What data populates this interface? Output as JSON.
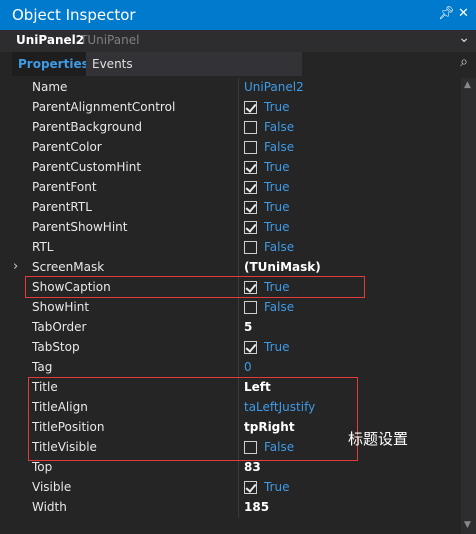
{
  "window": {
    "title": "Object Inspector"
  },
  "object": {
    "name": "UniPanel2",
    "type": "TUniPanel"
  },
  "tabs": {
    "properties": "Properties",
    "events": "Events"
  },
  "properties": [
    {
      "name": "Name",
      "value": "UniPanel2",
      "kind": "text",
      "style": "blue"
    },
    {
      "name": "ParentAlignmentControl",
      "value": "True",
      "kind": "check",
      "checked": true
    },
    {
      "name": "ParentBackground",
      "value": "False",
      "kind": "check",
      "checked": false
    },
    {
      "name": "ParentColor",
      "value": "False",
      "kind": "check",
      "checked": false
    },
    {
      "name": "ParentCustomHint",
      "value": "True",
      "kind": "check",
      "checked": true
    },
    {
      "name": "ParentFont",
      "value": "True",
      "kind": "check",
      "checked": true
    },
    {
      "name": "ParentRTL",
      "value": "True",
      "kind": "check",
      "checked": true
    },
    {
      "name": "ParentShowHint",
      "value": "True",
      "kind": "check",
      "checked": true
    },
    {
      "name": "RTL",
      "value": "False",
      "kind": "check",
      "checked": false
    },
    {
      "name": "ScreenMask",
      "value": "(TUniMask)",
      "kind": "text",
      "style": "bold",
      "expandable": true
    },
    {
      "name": "ShowCaption",
      "value": "True",
      "kind": "check",
      "checked": true
    },
    {
      "name": "ShowHint",
      "value": "False",
      "kind": "check",
      "checked": false
    },
    {
      "name": "TabOrder",
      "value": "5",
      "kind": "text",
      "style": "bold"
    },
    {
      "name": "TabStop",
      "value": "True",
      "kind": "check",
      "checked": true
    },
    {
      "name": "Tag",
      "value": "0",
      "kind": "text",
      "style": "blue"
    },
    {
      "name": "Title",
      "value": "Left",
      "kind": "text",
      "style": "bold"
    },
    {
      "name": "TitleAlign",
      "value": "taLeftJustify",
      "kind": "text",
      "style": "blue"
    },
    {
      "name": "TitlePosition",
      "value": "tpRight",
      "kind": "text",
      "style": "bold"
    },
    {
      "name": "TitleVisible",
      "value": "False",
      "kind": "check",
      "checked": false
    },
    {
      "name": "Top",
      "value": "83",
      "kind": "text",
      "style": "bold"
    },
    {
      "name": "Visible",
      "value": "True",
      "kind": "check",
      "checked": true
    },
    {
      "name": "Width",
      "value": "185",
      "kind": "text",
      "style": "bold"
    }
  ],
  "annotation": {
    "text": "标题设置"
  },
  "icons": {
    "pin": "pin-icon",
    "close": "close-icon",
    "dropdown": "chevron-down-icon",
    "search": "search-icon",
    "expander": "chevron-right-icon"
  },
  "colors": {
    "titlebar": "#007acc",
    "accent_blue": "#3e9be6",
    "highlight_red": "#e03c3c",
    "background": "#252526"
  }
}
